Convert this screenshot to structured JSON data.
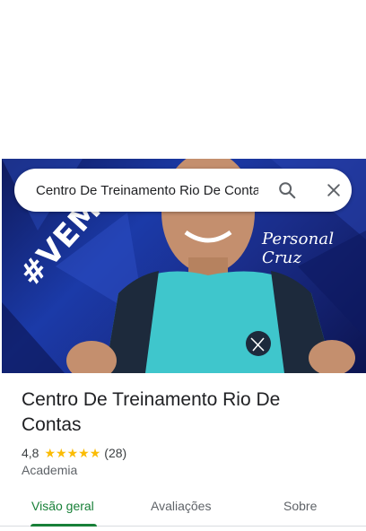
{
  "search": {
    "query": "Centro De Treinamento Rio De Contas",
    "search_icon": "search-icon",
    "close_icon": "close-icon"
  },
  "hero": {
    "brand_text": "Personal Cruz",
    "hashtag_text": "#VEMP",
    "accent": "#1b3aa8"
  },
  "place": {
    "title": "Centro De Treinamento Rio De Contas",
    "rating": "4,8",
    "stars": 5,
    "reviews": "(28)",
    "category": "Academia"
  },
  "tabs": [
    {
      "label": "Visão geral",
      "active": true
    },
    {
      "label": "Avaliações",
      "active": false
    },
    {
      "label": "Sobre",
      "active": false
    }
  ],
  "colors": {
    "active_tab": "#188038",
    "star": "#fbbc04"
  }
}
